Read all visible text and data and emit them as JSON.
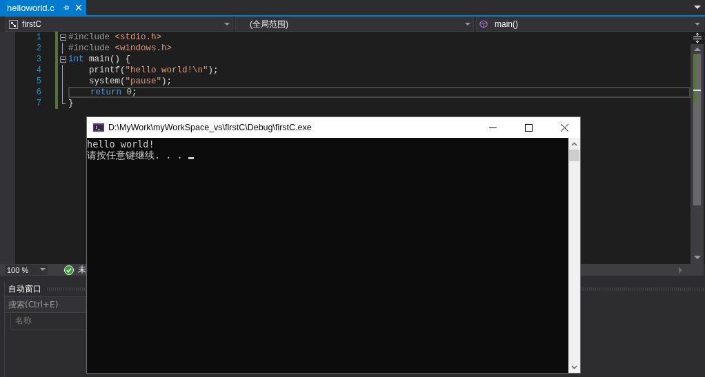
{
  "tab": {
    "title": "helloworld.c",
    "selected": true
  },
  "nav": [
    {
      "kind": "project",
      "text": "firstC"
    },
    {
      "kind": "scope",
      "text": "(全局范围)"
    },
    {
      "kind": "member",
      "text": "main()"
    }
  ],
  "code": [
    {
      "number": "1",
      "fold": true,
      "current": false,
      "tokens": [
        {
          "kind": "pre",
          "text": "#include "
        },
        {
          "kind": "header",
          "text": "<stdio.h>"
        }
      ]
    },
    {
      "number": "2",
      "fold": false,
      "current": false,
      "tokens": [
        {
          "kind": "pre",
          "text": "#include "
        },
        {
          "kind": "header",
          "text": "<windows.h>"
        }
      ]
    },
    {
      "number": "3",
      "fold": true,
      "current": false,
      "tokens": [
        {
          "kind": "keyword",
          "text": "int"
        },
        {
          "kind": "plain",
          "text": " main() {"
        }
      ]
    },
    {
      "number": "4",
      "fold": false,
      "current": false,
      "tokens": [
        {
          "kind": "plain",
          "text": "    printf("
        },
        {
          "kind": "string",
          "text": "\"hello world!\\n\""
        },
        {
          "kind": "plain",
          "text": ");"
        }
      ]
    },
    {
      "number": "5",
      "fold": false,
      "current": false,
      "tokens": [
        {
          "kind": "plain",
          "text": "    system("
        },
        {
          "kind": "string",
          "text": "\"pause\""
        },
        {
          "kind": "plain",
          "text": ");"
        }
      ]
    },
    {
      "number": "6",
      "fold": false,
      "current": true,
      "tokens": [
        {
          "kind": "keyword",
          "text": "    return"
        },
        {
          "kind": "number",
          "text": " 0"
        },
        {
          "kind": "plain",
          "text": ";"
        }
      ]
    },
    {
      "number": "7",
      "fold": false,
      "current": false,
      "tokens": [
        {
          "kind": "plain",
          "text": "}"
        }
      ]
    }
  ],
  "zoom": "100 %",
  "status": "未",
  "auto_window": {
    "title": "自动窗口",
    "placeholder": "搜索(Ctrl+E)",
    "columns": [
      "名称"
    ]
  },
  "console": {
    "title": "D:\\MyWork\\myWorkSpace_vs\\firstC\\Debug\\firstC.exe",
    "lines": [
      "hello world!",
      "请按任意键继续. . . "
    ]
  }
}
